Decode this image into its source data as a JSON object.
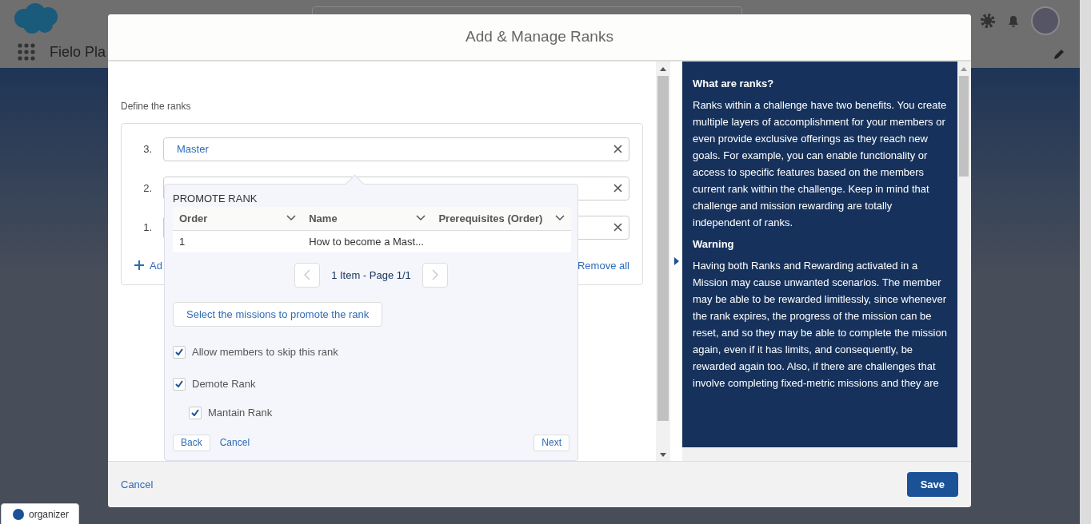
{
  "app": {
    "name": "Fielo Pla"
  },
  "modal": {
    "title": "Add & Manage Ranks",
    "section_label": "Define the ranks",
    "ranks": [
      {
        "number": "3.",
        "value": "Master"
      },
      {
        "number": "2."
      },
      {
        "number": "1."
      }
    ],
    "add_link": "Ad",
    "remove_all": "Remove all",
    "popover": {
      "title": "PROMOTE RANK",
      "columns": [
        "Order",
        "Name",
        "Prerequisites (Order)"
      ],
      "rows": [
        {
          "order": "1",
          "name": "How to become a Mast..."
        }
      ],
      "pagination": "1 Item - Page 1/1",
      "select_button": "Select the missions to promote the rank",
      "options": [
        {
          "label": "Allow members to skip this rank",
          "checked": true
        },
        {
          "label": "Demote Rank",
          "checked": true,
          "children": [
            {
              "label": "Mantain Rank",
              "checked": true
            }
          ]
        }
      ],
      "back": "Back",
      "cancel": "Cancel",
      "next": "Next"
    },
    "help": {
      "sections": [
        {
          "heading": "What are ranks?",
          "body": "Ranks within a challenge have two benefits. You create multiple layers of accomplishment for your members or even provide exclusive offerings as they reach new goals. For example, you can enable functionality or access to specific features based on the members current rank within the challenge. Keep in mind that challenge and mission rewarding are totally independent of ranks."
        },
        {
          "heading": "Warning",
          "body": "Having both Ranks and Rewarding activated in a Mission may cause unwanted scenarios. The member may be able to be rewarded limitlessly, since whenever the rank expires, the progress of the mission can be reset, and so they may be able to complete the mission again, even if it has limits, and consequently, be rewarded again too. Also, if there are challenges that involve completing fixed-metric missions and they are"
        }
      ]
    },
    "footer": {
      "cancel": "Cancel",
      "save": "Save"
    }
  },
  "badge": {
    "label": "organizer"
  }
}
